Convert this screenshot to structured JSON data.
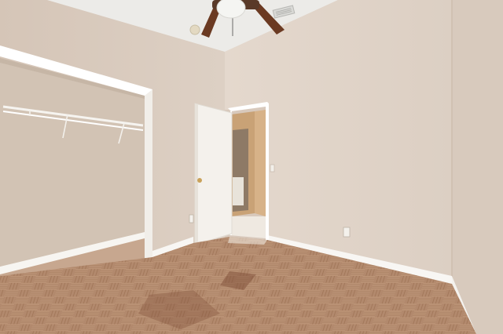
{
  "scene": {
    "kind": "empty bedroom interior photo",
    "elements": [
      "ceiling-fan",
      "ceiling-vent",
      "open-closet",
      "closet-rod",
      "interior-door",
      "hallway-doorway",
      "parquet-floor",
      "baseboard",
      "wall-outlet",
      "light-switch"
    ]
  },
  "colors": {
    "ceiling": "#eceae6",
    "wall_left": "#d9cabd",
    "wall_right": "#e2d5ca",
    "wall_corner": "#d6c7ba",
    "closet_interior": "#d2c3b4",
    "trim": "#ffffff",
    "door": "#f4f1ec",
    "hallway": "#cba47b",
    "floor": "#b88f72",
    "floor_dark": "#8d6049",
    "fan_blade": "#6b3a22",
    "fan_light": "#f5f5f2"
  }
}
